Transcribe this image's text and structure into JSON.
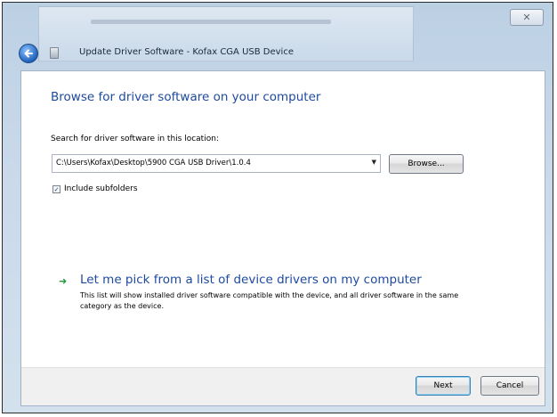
{
  "window": {
    "title": "Update Driver Software - Kofax CGA USB Device",
    "close_glyph": "✕",
    "icons": {
      "back": "back-arrow-icon",
      "device": "usb-device-icon",
      "close": "close-icon"
    }
  },
  "page": {
    "heading": "Browse for driver software on your computer",
    "search_label": "Search for driver software in this location:",
    "path_value": "C:\\Users\\Kofax\\Desktop\\5900 CGA USB Driver\\1.0.4",
    "combo_arrow_glyph": "▼",
    "browse_label": "Browse...",
    "include_subfolders": {
      "label": "Include subfolders",
      "checked": true,
      "check_glyph": "✓"
    },
    "pick": {
      "arrow_glyph": "➜",
      "title": "Let me pick from a list of device drivers on my computer",
      "description": "This list will show installed driver software compatible with the device, and all driver software in the same category as the device."
    }
  },
  "footer": {
    "next_label": "Next",
    "cancel_label": "Cancel"
  },
  "colors": {
    "heading_blue": "#1e4aa0",
    "link_arrow_green": "#1f9a3a",
    "frame_blue": "#c9d9ea"
  }
}
